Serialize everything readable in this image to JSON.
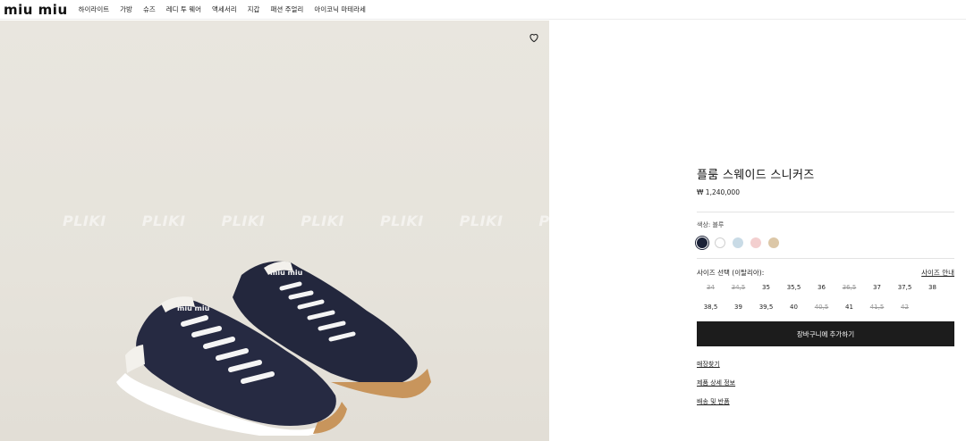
{
  "header": {
    "logo": "miu miu",
    "nav": [
      "하이라이트",
      "가방",
      "슈즈",
      "레디 투 웨어",
      "액세서리",
      "지갑",
      "패션 주얼리",
      "아이코닉 마테라세"
    ]
  },
  "image": {
    "watermark": [
      "PLIKI",
      "PLIKI",
      "PLIKI",
      "PLIKI",
      "PLIKI",
      "PLIKI",
      "PLIKI"
    ],
    "wishlist_icon": "heart-icon"
  },
  "product": {
    "title": "플룸 스웨이드 스니커즈",
    "price": "₩ 1,240,000",
    "color_label": "색상:  블루",
    "swatches": [
      {
        "color": "#1b2238",
        "selected": true
      },
      {
        "color": "#ffffff",
        "selected": false
      },
      {
        "color": "#c9dbe6",
        "selected": false
      },
      {
        "color": "#f3cfcf",
        "selected": false
      },
      {
        "color": "#dcc7a7",
        "selected": false
      }
    ],
    "size_label": "사이즈 선택 (이탈리아):",
    "size_guide": "사이즈 안내",
    "sizes": [
      {
        "label": "34",
        "available": false
      },
      {
        "label": "34,5",
        "available": false
      },
      {
        "label": "35",
        "available": true
      },
      {
        "label": "35,5",
        "available": true
      },
      {
        "label": "36",
        "available": true
      },
      {
        "label": "36,5",
        "available": false
      },
      {
        "label": "37",
        "available": true
      },
      {
        "label": "37,5",
        "available": true
      },
      {
        "label": "38",
        "available": true
      },
      {
        "label": "38,5",
        "available": true
      },
      {
        "label": "39",
        "available": true
      },
      {
        "label": "39,5",
        "available": true
      },
      {
        "label": "40",
        "available": true
      },
      {
        "label": "40,5",
        "available": false
      },
      {
        "label": "41",
        "available": true
      },
      {
        "label": "41,5",
        "available": false
      },
      {
        "label": "42",
        "available": false
      }
    ],
    "cart_button": "장바구니에 추가하기",
    "links": [
      "매장찾기",
      "제품 상세 정보",
      "배송 및 반품"
    ]
  }
}
